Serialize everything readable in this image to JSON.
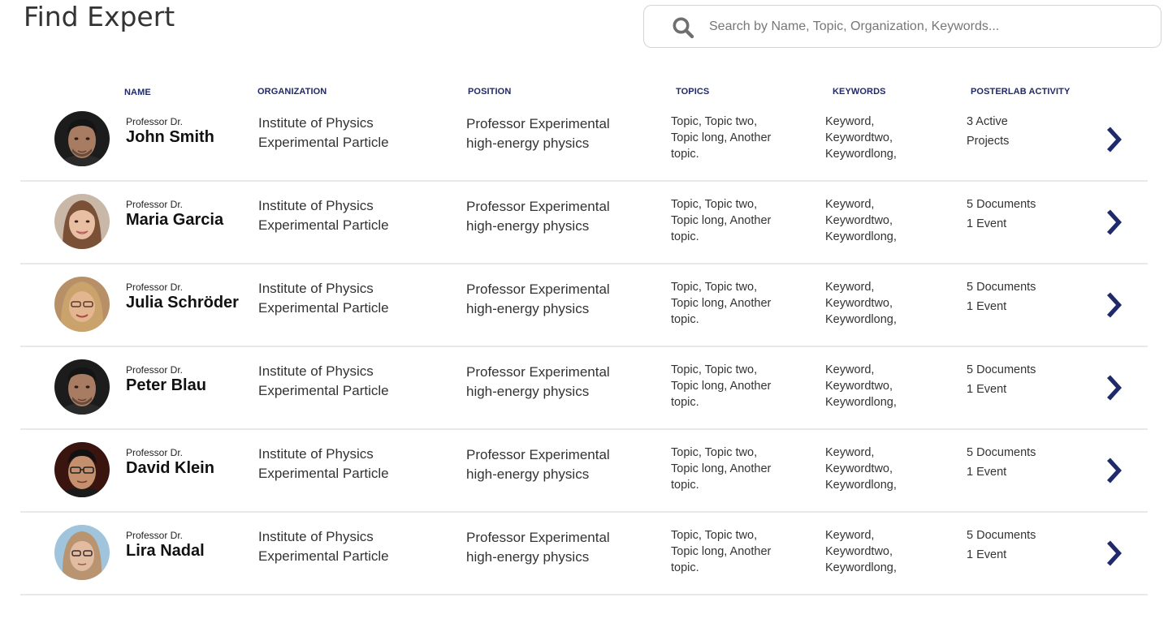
{
  "page": {
    "title": "Find Expert"
  },
  "search": {
    "placeholder": "Search by Name, Topic, Organization, Keywords...",
    "icon": "search-icon"
  },
  "colors": {
    "header_text": "#1f2a6b",
    "arrow": "#1f2a6b",
    "divider": "#e8e8e8"
  },
  "columns": {
    "name": "NAME",
    "organization": "ORGANIZATION",
    "position": "POSITION",
    "topics": "TOPICS",
    "keywords": "KEYWORDS",
    "activity": "POSTERLAB ACTIVITY"
  },
  "experts": [
    {
      "title": "Professor Dr.",
      "name": "John Smith",
      "org_line1": "Institute of Physics",
      "org_line2": "Experimental Particle",
      "pos_line1": "Professor Experimental",
      "pos_line2": "high-energy physics",
      "topics_line1": "Topic, Topic two,",
      "topics_line2": "Topic long, Another",
      "topics_line3": "topic.",
      "kw_line1": "Keyword,",
      "kw_line2": "Keywordtwo,",
      "kw_line3": "Keywordlong,",
      "activity_line1": "3 Active",
      "activity_line2": "Projects",
      "avatar": "male-dark-hair"
    },
    {
      "title": "Professor Dr.",
      "name": "Maria Garcia",
      "org_line1": "Institute of Physics",
      "org_line2": "Experimental Particle",
      "pos_line1": "Professor Experimental",
      "pos_line2": "high-energy physics",
      "topics_line1": "Topic, Topic two,",
      "topics_line2": "Topic long, Another",
      "topics_line3": "topic.",
      "kw_line1": "Keyword,",
      "kw_line2": "Keywordtwo,",
      "kw_line3": "Keywordlong,",
      "activity_line1": "5 Documents",
      "activity_line2": "1 Event",
      "avatar": "female-brown-hair"
    },
    {
      "title": "Professor Dr.",
      "name": "Julia Schröder",
      "org_line1": "Institute of Physics",
      "org_line2": "Experimental Particle",
      "pos_line1": "Professor Experimental",
      "pos_line2": "high-energy physics",
      "topics_line1": "Topic, Topic two,",
      "topics_line2": "Topic long, Another",
      "topics_line3": "topic.",
      "kw_line1": "Keyword,",
      "kw_line2": "Keywordtwo,",
      "kw_line3": "Keywordlong,",
      "activity_line1": "5 Documents",
      "activity_line2": "1 Event",
      "avatar": "female-blonde-glasses"
    },
    {
      "title": "Professor Dr.",
      "name": "Peter Blau",
      "org_line1": "Institute of Physics",
      "org_line2": "Experimental Particle",
      "pos_line1": "Professor Experimental",
      "pos_line2": "high-energy physics",
      "topics_line1": "Topic, Topic two,",
      "topics_line2": "Topic long, Another",
      "topics_line3": "topic.",
      "kw_line1": "Keyword,",
      "kw_line2": "Keywordtwo,",
      "kw_line3": "Keywordlong,",
      "activity_line1": "5 Documents",
      "activity_line2": "1 Event",
      "avatar": "male-dark-hair"
    },
    {
      "title": "Professor Dr.",
      "name": "David Klein",
      "org_line1": "Institute of Physics",
      "org_line2": "Experimental Particle",
      "pos_line1": "Professor Experimental",
      "pos_line2": "high-energy physics",
      "topics_line1": "Topic, Topic two,",
      "topics_line2": "Topic long, Another",
      "topics_line3": "topic.",
      "kw_line1": "Keyword,",
      "kw_line2": "Keywordtwo,",
      "kw_line3": "Keywordlong,",
      "activity_line1": "5 Documents",
      "activity_line2": "1 Event",
      "avatar": "male-glasses"
    },
    {
      "title": "Professor Dr.",
      "name": "Lira Nadal",
      "org_line1": "Institute of Physics",
      "org_line2": "Experimental Particle",
      "pos_line1": "Professor Experimental",
      "pos_line2": "high-energy physics",
      "topics_line1": "Topic, Topic two,",
      "topics_line2": "Topic long, Another",
      "topics_line3": "topic.",
      "kw_line1": "Keyword,",
      "kw_line2": "Keywordtwo,",
      "kw_line3": "Keywordlong,",
      "activity_line1": "5 Documents",
      "activity_line2": "1 Event",
      "avatar": "female-glasses-light-hair"
    }
  ]
}
